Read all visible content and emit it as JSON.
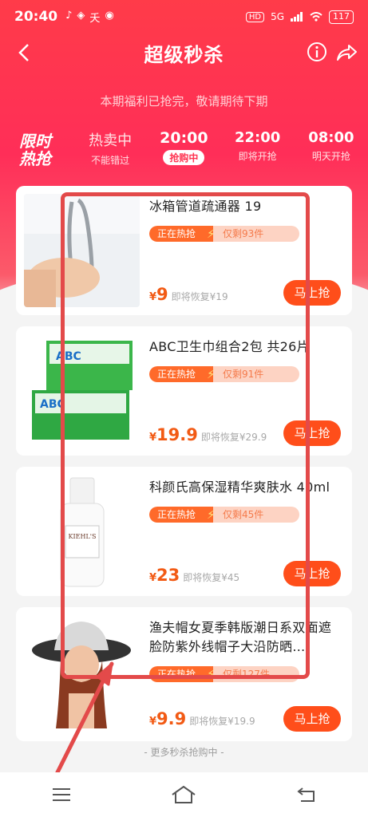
{
  "status_bar": {
    "time": "20:40",
    "apps": [
      "♪",
      "◈",
      "夭",
      "◉"
    ],
    "hd": "HD",
    "net": "5G",
    "battery": "117"
  },
  "header": {
    "title": "超级秒杀",
    "notice": "本期福利已抢完，敬请期待下期"
  },
  "tabs": {
    "logo_line1": "限时",
    "logo_line2": "热抢",
    "items": [
      {
        "time": "热卖中",
        "sub": "不能错过"
      },
      {
        "time": "20:00",
        "sub": "抢购中"
      },
      {
        "time": "22:00",
        "sub": "即将开抢"
      },
      {
        "time": "08:00",
        "sub": "明天开抢"
      }
    ]
  },
  "products": [
    {
      "name": "冰箱管道疏通器 19",
      "hot": "正在热抢",
      "remain": "仅剩93件",
      "yen": "¥",
      "price": "9",
      "orig": "即将恢复¥19",
      "buy": "马上抢"
    },
    {
      "name": "ABC卫生巾组合2包 共26片",
      "hot": "正在热抢",
      "remain": "仅剩91件",
      "yen": "¥",
      "price": "19.9",
      "orig": "即将恢复¥29.9",
      "buy": "马上抢"
    },
    {
      "name": "科颜氏高保湿精华爽肤水 40ml",
      "hot": "正在热抢",
      "remain": "仅剩45件",
      "yen": "¥",
      "price": "23",
      "orig": "即将恢复¥45",
      "buy": "马上抢"
    },
    {
      "name": "渔夫帽女夏季韩版潮日系双面遮脸防紫外线帽子大沿防晒…",
      "hot": "正在热抢",
      "remain": "仅剩127件",
      "yen": "¥",
      "price": "9.9",
      "orig": "即将恢复¥19.9",
      "buy": "马上抢"
    }
  ],
  "footer": {
    "more": "- 更多秒杀抢购中 -"
  },
  "colors": {
    "brand": "#ff2e58",
    "price": "#f25a14",
    "button": "#ff4e1a",
    "overlay": "#e34a4a"
  }
}
